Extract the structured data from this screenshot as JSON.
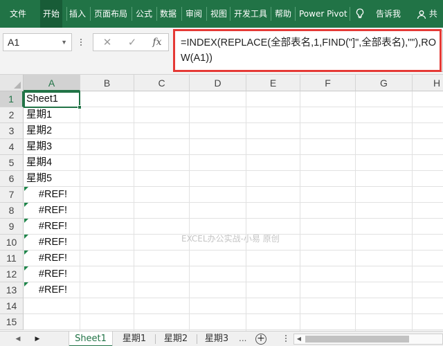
{
  "ribbon": {
    "tabs": [
      "文件",
      "开始",
      "插入",
      "页面布局",
      "公式",
      "数据",
      "审阅",
      "视图",
      "开发工具",
      "帮助",
      "Power Pivot"
    ],
    "tell_me": "告诉我",
    "share": "共"
  },
  "formula_bar": {
    "name_box": "A1",
    "cancel_icon": "✕",
    "enter_icon": "✓",
    "fx_label": "fx",
    "formula": "=INDEX(REPLACE(全部表名,1,FIND(\"]\",全部表名),\"\"),ROW(A1))"
  },
  "grid": {
    "columns": [
      "A",
      "B",
      "C",
      "D",
      "E",
      "F",
      "G",
      "H"
    ],
    "rows": [
      "1",
      "2",
      "3",
      "4",
      "5",
      "6",
      "7",
      "8",
      "9",
      "10",
      "11",
      "12",
      "13",
      "14",
      "15"
    ],
    "selected_column": "A",
    "selected_row": "1",
    "col_a_values": [
      "Sheet1",
      "星期1",
      "星期2",
      "星期3",
      "星期4",
      "星期5",
      "#REF!",
      "#REF!",
      "#REF!",
      "#REF!",
      "#REF!",
      "#REF!",
      "#REF!",
      "",
      ""
    ],
    "watermark": "EXCEL办公实战-小易  原创"
  },
  "sheet_tabs": {
    "tabs": [
      "Sheet1",
      "星期1",
      "星期2",
      "星期3"
    ],
    "active": "Sheet1",
    "more": "..."
  },
  "colors": {
    "accent": "#217346",
    "error_indicator": "#1e8449",
    "highlight_frame": "#e53935"
  }
}
